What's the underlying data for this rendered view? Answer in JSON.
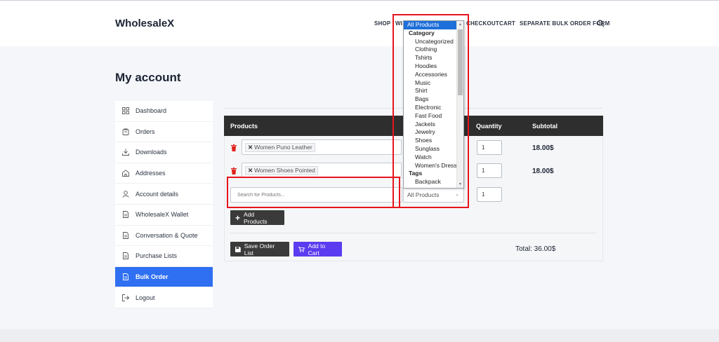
{
  "header": {
    "logo": "WholesaleX",
    "nav": [
      "SHOP",
      "WI",
      "CHECKOUT",
      "CART",
      "SEPARATE BULK ORDER FORM"
    ]
  },
  "page_title": "My account",
  "sidebar": {
    "items": [
      {
        "label": "Dashboard",
        "icon": "dashboard-grid-icon"
      },
      {
        "label": "Orders",
        "icon": "orders-bag-icon"
      },
      {
        "label": "Downloads",
        "icon": "download-icon"
      },
      {
        "label": "Addresses",
        "icon": "home-icon"
      },
      {
        "label": "Account details",
        "icon": "user-icon"
      },
      {
        "label": "WholesaleX Wallet",
        "icon": "document-icon"
      },
      {
        "label": "Conversation & Quote",
        "icon": "document-icon"
      },
      {
        "label": "Purchase Lists",
        "icon": "document-icon"
      },
      {
        "label": "Bulk Order",
        "icon": "document-icon"
      },
      {
        "label": "Logout",
        "icon": "logout-icon"
      }
    ],
    "active": "Bulk Order"
  },
  "table": {
    "headers": {
      "products": "Products",
      "quantity": "Quantity",
      "subtotal": "Subtotal"
    },
    "rows": [
      {
        "product": "Women Puno Leather",
        "quantity": "1",
        "subtotal": "18.00$"
      },
      {
        "product": "Women Shoes Pointed",
        "quantity": "1",
        "subtotal": "18.00$"
      }
    ],
    "new_row": {
      "search_placeholder": "Search for Products...",
      "category_value": "All Products",
      "quantity": "1"
    }
  },
  "buttons": {
    "add_products": "Add Products",
    "save_order_list": "Save Order List",
    "add_to_cart": "Add to Cart"
  },
  "total": "Total: 36.00$",
  "dropdown": {
    "selected": "All Products",
    "groups": [
      {
        "label": "Category",
        "options": [
          "Uncategorized",
          "Clothing",
          "Tshirts",
          "Hoodies",
          "Accessories",
          "Music",
          "Shirt",
          "Bags",
          "Electronic",
          "Fast Food",
          "Jackets",
          "Jewelry",
          "Shoes",
          "Sunglass",
          "Watch",
          "Women's Dress"
        ]
      },
      {
        "label": "Tags",
        "options": [
          "Backpack"
        ]
      }
    ]
  },
  "colors": {
    "accent_blue": "#2f6ff1",
    "purple": "#5b3cf0",
    "header_dark": "#2e2e2e",
    "highlight_red": "#e8141d",
    "trash_red": "#e0211b"
  }
}
